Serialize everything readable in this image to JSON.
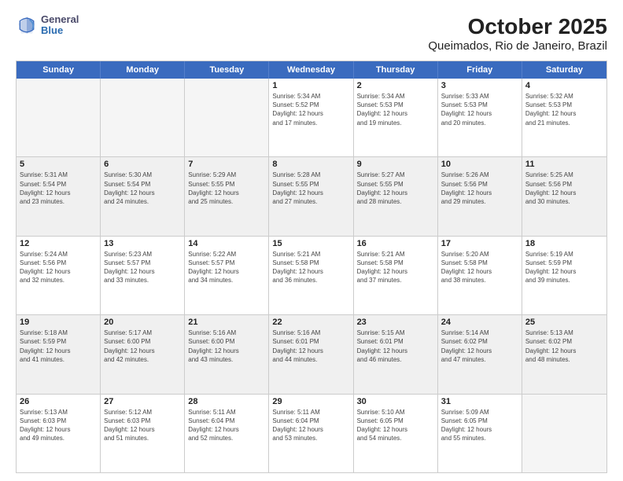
{
  "logo": {
    "general": "General",
    "blue": "Blue"
  },
  "title": "October 2025",
  "subtitle": "Queimados, Rio de Janeiro, Brazil",
  "days": [
    "Sunday",
    "Monday",
    "Tuesday",
    "Wednesday",
    "Thursday",
    "Friday",
    "Saturday"
  ],
  "weeks": [
    [
      {
        "day": "",
        "info": "",
        "empty": true
      },
      {
        "day": "",
        "info": "",
        "empty": true
      },
      {
        "day": "",
        "info": "",
        "empty": true
      },
      {
        "day": "1",
        "info": "Sunrise: 5:34 AM\nSunset: 5:52 PM\nDaylight: 12 hours\nand 17 minutes."
      },
      {
        "day": "2",
        "info": "Sunrise: 5:34 AM\nSunset: 5:53 PM\nDaylight: 12 hours\nand 19 minutes."
      },
      {
        "day": "3",
        "info": "Sunrise: 5:33 AM\nSunset: 5:53 PM\nDaylight: 12 hours\nand 20 minutes."
      },
      {
        "day": "4",
        "info": "Sunrise: 5:32 AM\nSunset: 5:53 PM\nDaylight: 12 hours\nand 21 minutes."
      }
    ],
    [
      {
        "day": "5",
        "info": "Sunrise: 5:31 AM\nSunset: 5:54 PM\nDaylight: 12 hours\nand 23 minutes."
      },
      {
        "day": "6",
        "info": "Sunrise: 5:30 AM\nSunset: 5:54 PM\nDaylight: 12 hours\nand 24 minutes."
      },
      {
        "day": "7",
        "info": "Sunrise: 5:29 AM\nSunset: 5:55 PM\nDaylight: 12 hours\nand 25 minutes."
      },
      {
        "day": "8",
        "info": "Sunrise: 5:28 AM\nSunset: 5:55 PM\nDaylight: 12 hours\nand 27 minutes."
      },
      {
        "day": "9",
        "info": "Sunrise: 5:27 AM\nSunset: 5:55 PM\nDaylight: 12 hours\nand 28 minutes."
      },
      {
        "day": "10",
        "info": "Sunrise: 5:26 AM\nSunset: 5:56 PM\nDaylight: 12 hours\nand 29 minutes."
      },
      {
        "day": "11",
        "info": "Sunrise: 5:25 AM\nSunset: 5:56 PM\nDaylight: 12 hours\nand 30 minutes."
      }
    ],
    [
      {
        "day": "12",
        "info": "Sunrise: 5:24 AM\nSunset: 5:56 PM\nDaylight: 12 hours\nand 32 minutes."
      },
      {
        "day": "13",
        "info": "Sunrise: 5:23 AM\nSunset: 5:57 PM\nDaylight: 12 hours\nand 33 minutes."
      },
      {
        "day": "14",
        "info": "Sunrise: 5:22 AM\nSunset: 5:57 PM\nDaylight: 12 hours\nand 34 minutes."
      },
      {
        "day": "15",
        "info": "Sunrise: 5:21 AM\nSunset: 5:58 PM\nDaylight: 12 hours\nand 36 minutes."
      },
      {
        "day": "16",
        "info": "Sunrise: 5:21 AM\nSunset: 5:58 PM\nDaylight: 12 hours\nand 37 minutes."
      },
      {
        "day": "17",
        "info": "Sunrise: 5:20 AM\nSunset: 5:58 PM\nDaylight: 12 hours\nand 38 minutes."
      },
      {
        "day": "18",
        "info": "Sunrise: 5:19 AM\nSunset: 5:59 PM\nDaylight: 12 hours\nand 39 minutes."
      }
    ],
    [
      {
        "day": "19",
        "info": "Sunrise: 5:18 AM\nSunset: 5:59 PM\nDaylight: 12 hours\nand 41 minutes."
      },
      {
        "day": "20",
        "info": "Sunrise: 5:17 AM\nSunset: 6:00 PM\nDaylight: 12 hours\nand 42 minutes."
      },
      {
        "day": "21",
        "info": "Sunrise: 5:16 AM\nSunset: 6:00 PM\nDaylight: 12 hours\nand 43 minutes."
      },
      {
        "day": "22",
        "info": "Sunrise: 5:16 AM\nSunset: 6:01 PM\nDaylight: 12 hours\nand 44 minutes."
      },
      {
        "day": "23",
        "info": "Sunrise: 5:15 AM\nSunset: 6:01 PM\nDaylight: 12 hours\nand 46 minutes."
      },
      {
        "day": "24",
        "info": "Sunrise: 5:14 AM\nSunset: 6:02 PM\nDaylight: 12 hours\nand 47 minutes."
      },
      {
        "day": "25",
        "info": "Sunrise: 5:13 AM\nSunset: 6:02 PM\nDaylight: 12 hours\nand 48 minutes."
      }
    ],
    [
      {
        "day": "26",
        "info": "Sunrise: 5:13 AM\nSunset: 6:03 PM\nDaylight: 12 hours\nand 49 minutes."
      },
      {
        "day": "27",
        "info": "Sunrise: 5:12 AM\nSunset: 6:03 PM\nDaylight: 12 hours\nand 51 minutes."
      },
      {
        "day": "28",
        "info": "Sunrise: 5:11 AM\nSunset: 6:04 PM\nDaylight: 12 hours\nand 52 minutes."
      },
      {
        "day": "29",
        "info": "Sunrise: 5:11 AM\nSunset: 6:04 PM\nDaylight: 12 hours\nand 53 minutes."
      },
      {
        "day": "30",
        "info": "Sunrise: 5:10 AM\nSunset: 6:05 PM\nDaylight: 12 hours\nand 54 minutes."
      },
      {
        "day": "31",
        "info": "Sunrise: 5:09 AM\nSunset: 6:05 PM\nDaylight: 12 hours\nand 55 minutes."
      },
      {
        "day": "",
        "info": "",
        "empty": true
      }
    ]
  ],
  "colors": {
    "header_bg": "#3a6bbf",
    "alt_row_bg": "#f0f0f0"
  }
}
